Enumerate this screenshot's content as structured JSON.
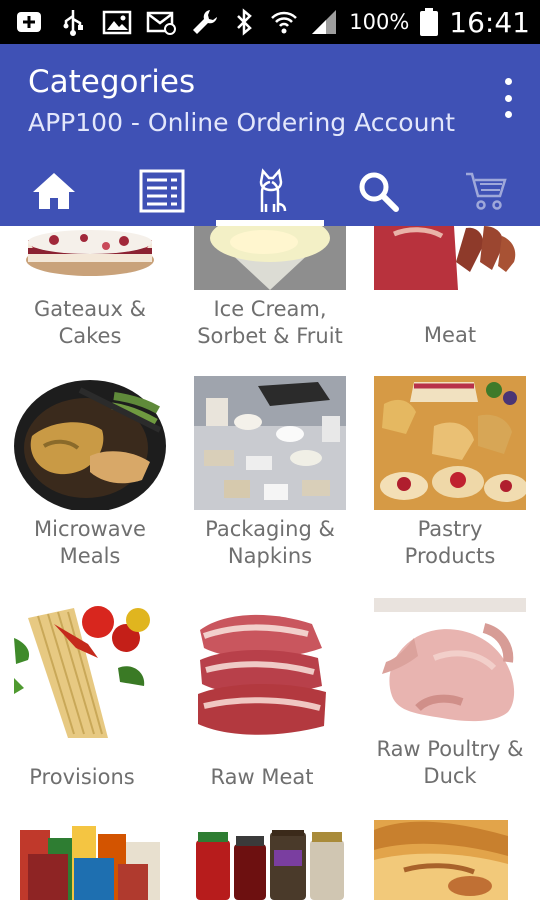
{
  "status_bar": {
    "battery_percent": "100%",
    "time": "16:41",
    "left_icons": [
      "plus-box-icon",
      "usb-icon",
      "image-icon",
      "mail-icon",
      "wrench-icon"
    ],
    "right_icons": [
      "bluetooth-icon",
      "wifi-icon",
      "signal-icon",
      "battery-icon"
    ]
  },
  "app_bar": {
    "title": "Categories",
    "subtitle": "APP100 - Online Ordering Account",
    "colors": {
      "primary": "#3f51b5"
    }
  },
  "tabs": [
    {
      "icon": "home-icon",
      "selected": false
    },
    {
      "icon": "list-icon",
      "selected": false
    },
    {
      "icon": "cat-icon",
      "selected": true
    },
    {
      "icon": "search-icon",
      "selected": false
    },
    {
      "icon": "cart-icon",
      "selected": false,
      "disabled": true
    }
  ],
  "categories": [
    {
      "label_line1": "Gateaux &",
      "label_line2": "Cakes",
      "image": "cake"
    },
    {
      "label_line1": "Ice Cream,",
      "label_line2": "Sorbet & Fruit",
      "image": "ice-cream"
    },
    {
      "label_line1": "Meat",
      "label_line2": "",
      "image": "meat"
    },
    {
      "label_line1": "Microwave",
      "label_line2": "Meals",
      "image": "microwave-meal"
    },
    {
      "label_line1": "Packaging &",
      "label_line2": "Napkins",
      "image": "packaging"
    },
    {
      "label_line1": "Pastry",
      "label_line2": "Products",
      "image": "pastry"
    },
    {
      "label_line1": "Provisions",
      "label_line2": "",
      "image": "pasta"
    },
    {
      "label_line1": "Raw Meat",
      "label_line2": "",
      "image": "raw-meat"
    },
    {
      "label_line1": "Raw Poultry &",
      "label_line2": "Duck",
      "image": "poultry"
    },
    {
      "label_line1": "",
      "label_line2": "",
      "image": "groceries"
    },
    {
      "label_line1": "",
      "label_line2": "",
      "image": "jars"
    },
    {
      "label_line1": "",
      "label_line2": "",
      "image": "baked"
    }
  ]
}
